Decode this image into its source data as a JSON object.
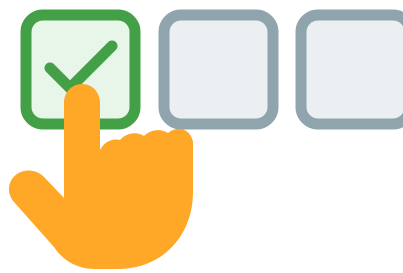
{
  "checkboxes": [
    {
      "state": "checked",
      "icon": "checkmark-icon"
    },
    {
      "state": "unchecked",
      "icon": null
    },
    {
      "state": "unchecked",
      "icon": null
    }
  ],
  "pointer": {
    "icon": "hand-pointer-icon"
  },
  "colors": {
    "checked_border": "#43A047",
    "checked_fill": "#E8F5E9",
    "unchecked_border": "#90A4AE",
    "unchecked_fill": "#ECEFF1",
    "checkmark": "#43A047",
    "hand": "#FFA726",
    "background": "#FFFFFF"
  }
}
